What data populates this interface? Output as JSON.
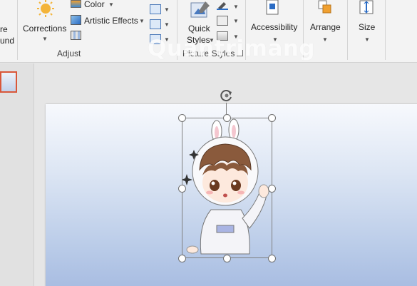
{
  "ribbon": {
    "remove_background": {
      "line1": "re",
      "line2": "und"
    },
    "corrections": "Corrections",
    "color": "Color",
    "artistic_effects": "Artistic Effects",
    "adjust_group": "Adjust",
    "quick_styles": {
      "line1": "Quick",
      "line2": "Styles"
    },
    "picture_styles_group": "Picture Styles",
    "accessibility": "Accessibility",
    "arrange": "Arrange",
    "size": "Size"
  },
  "watermark": "Quantrimang",
  "colors": {
    "ribbon_bg": "#f3f3f3",
    "thumbnail_border": "#d9573a",
    "slide_gradient_top": "#f7f9fd",
    "slide_gradient_bottom": "#a4b9e0",
    "accent_orange": "#f0a030",
    "accent_blue": "#2b6cc4"
  },
  "icons": [
    "sun-corrections-icon",
    "color-icon",
    "artistic-effects-icon",
    "compress-icon",
    "change-picture-icon",
    "reset-picture-icon",
    "quick-styles-icon",
    "picture-border-icon",
    "picture-effects-icon",
    "picture-layout-icon",
    "accessibility-icon",
    "arrange-icon",
    "size-icon",
    "rotate-handle-icon",
    "dialog-launcher-icon"
  ]
}
